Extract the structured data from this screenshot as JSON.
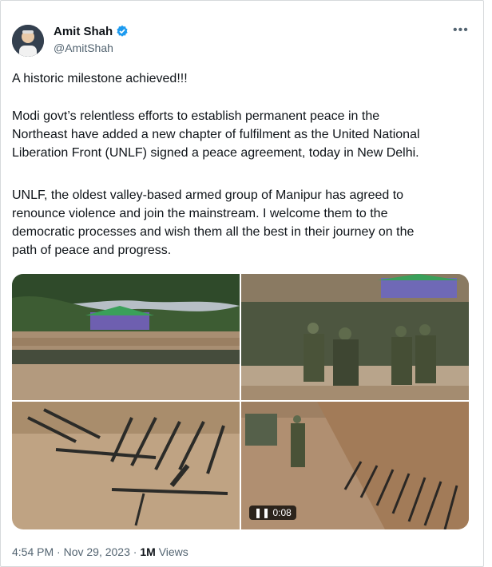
{
  "author": {
    "name": "Amit Shah",
    "handle": "@AmitShah"
  },
  "tweet": {
    "line1": "A historic milestone achieved!!!",
    "p2": [
      "Modi govt’s relentless efforts to establish permanent peace in the",
      "Northeast have added a new chapter of fulfilment as the United National",
      "Liberation Front (UNLF) signed a peace agreement, today in New Delhi."
    ],
    "p3": [
      "UNLF, the oldest valley-based armed group of Manipur has agreed to",
      "renounce violence and join the mainstream. I welcome them to the",
      "democratic processes and wish them all the best in their journey on the",
      "path of peace and progress."
    ]
  },
  "video": {
    "duration": "0:08"
  },
  "meta": {
    "time": "4:54 PM",
    "date": "Nov 29, 2023",
    "views_count": "1M",
    "views_label": "Views"
  },
  "icons": {
    "verified": "verified-badge-icon",
    "more": "more-icon",
    "play": "pause-icon"
  },
  "colors": {
    "verified": "#1d9bf0",
    "meta": "#536471"
  }
}
